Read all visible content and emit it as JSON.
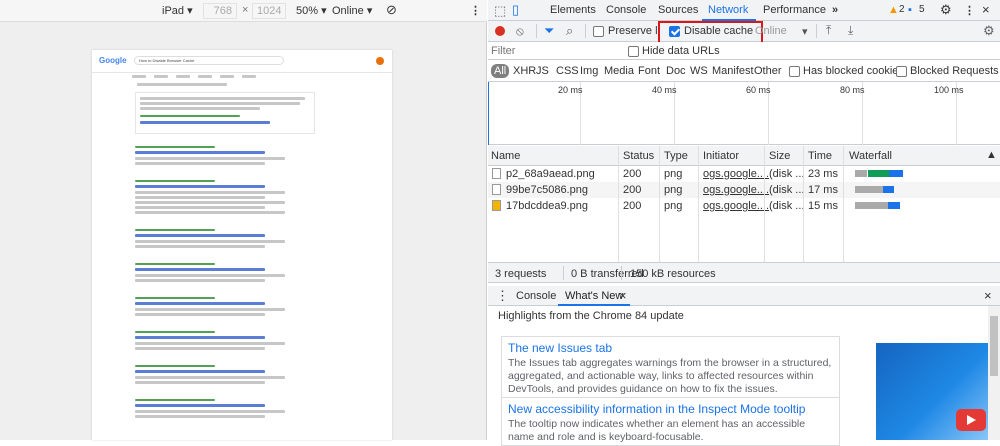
{
  "device_bar": {
    "device": "iPad",
    "width": "768",
    "x": "×",
    "height": "1024",
    "zoom": "50%",
    "throttle": "Online"
  },
  "google_page": {
    "logo": "Google",
    "search_text": "How to Disable Browser Cache"
  },
  "devtools": {
    "tabs": [
      "Elements",
      "Console",
      "Sources",
      "Network",
      "Performance"
    ],
    "more": "»",
    "warnings": "2",
    "messages": "5",
    "toolbar": {
      "preserve_log": "Preserve log",
      "disable_cache": "Disable cache",
      "online": "Online"
    },
    "filter": {
      "placeholder": "Filter",
      "hide_data_urls": "Hide data URLs"
    },
    "types": [
      "All",
      "XHR",
      "JS",
      "CSS",
      "Img",
      "Media",
      "Font",
      "Doc",
      "WS",
      "Manifest",
      "Other"
    ],
    "has_blocked_cookies": "Has blocked cookies",
    "blocked_requests": "Blocked Requests",
    "timeline_ticks": [
      "20 ms",
      "40 ms",
      "60 ms",
      "80 ms",
      "100 ms"
    ],
    "columns": [
      "Name",
      "Status",
      "Type",
      "Initiator",
      "Size",
      "Time",
      "Waterfall"
    ],
    "requests": [
      {
        "name": "p2_68a9aead.png",
        "status": "200",
        "type": "png",
        "initiator": "ogs.google....",
        "size": "(disk ...",
        "time": "23 ms"
      },
      {
        "name": "99be7c5086.png",
        "status": "200",
        "type": "png",
        "initiator": "ogs.google....",
        "size": "(disk ...",
        "time": "17 ms"
      },
      {
        "name": "17bdcddea9.png",
        "status": "200",
        "type": "png",
        "initiator": "ogs.google....",
        "size": "(disk ...",
        "time": "15 ms"
      }
    ],
    "summary": {
      "requests": "3 requests",
      "transferred": "0 B transferred",
      "resources": "150 kB resources"
    },
    "drawer": {
      "tab_console": "Console",
      "tab_whats_new": "What's New",
      "close": "×",
      "highlights": "Highlights from the Chrome 84 update",
      "item1_title": "The new Issues tab",
      "item1_body": "The Issues tab aggregates warnings from the browser in a structured, aggregated, and actionable way, links to affected resources within DevTools, and provides guidance on how to fix the issues.",
      "item2_title": "New accessibility information in the Inspect Mode tooltip",
      "item2_body": "The tooltip now indicates whether an element has an accessible name and role and is keyboard-focusable."
    }
  },
  "colors": {
    "accent": "#1a73e8",
    "highlight_box": "#d7191c",
    "record": "#d93025"
  }
}
